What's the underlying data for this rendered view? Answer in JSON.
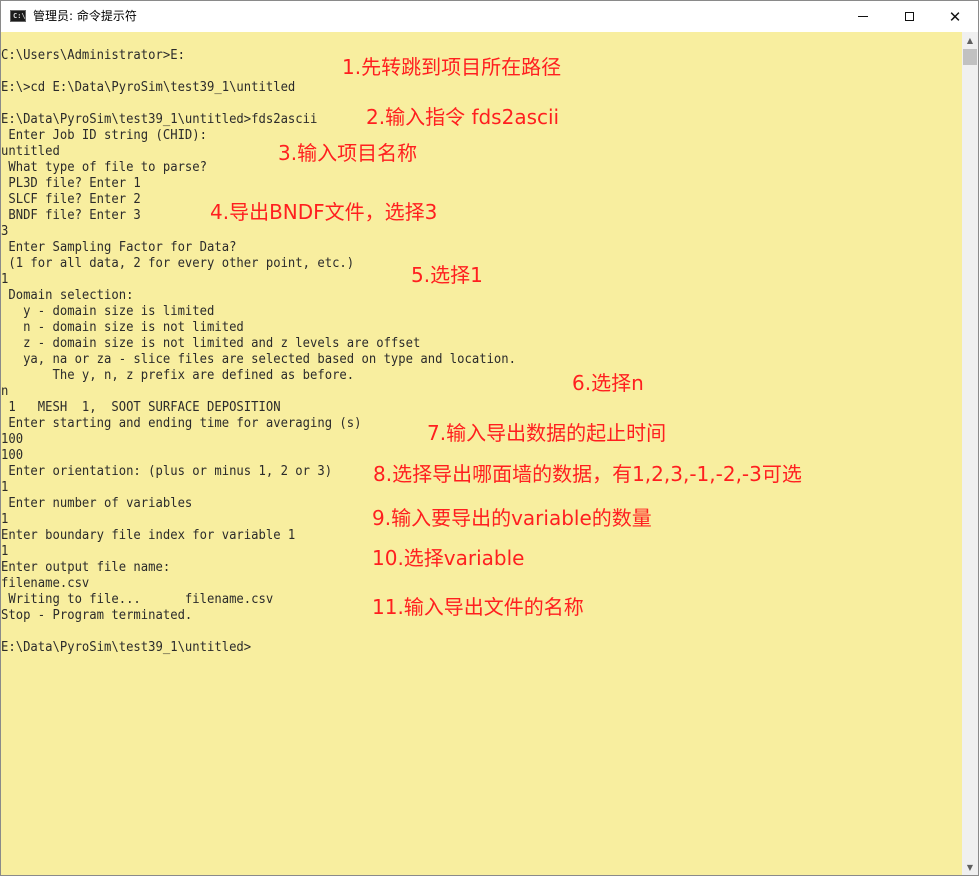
{
  "window": {
    "title": "管理员: 命令提示符",
    "icon": "cmd-console-icon",
    "icon_text": "C:\\",
    "controls": {
      "minimize": "minimize-icon",
      "maximize": "maximize-icon",
      "close": "close-icon"
    },
    "close_glyph": "✕",
    "background": "#f8ee9f",
    "annotation_color": "#ff1f1f"
  },
  "console_lines": [
    "C:\\Users\\Administrator>E:",
    "",
    "E:\\>cd E:\\Data\\PyroSim\\test39_1\\untitled",
    "",
    "E:\\Data\\PyroSim\\test39_1\\untitled>fds2ascii",
    " Enter Job ID string (CHID):",
    "untitled",
    " What type of file to parse?",
    " PL3D file? Enter 1",
    " SLCF file? Enter 2",
    " BNDF file? Enter 3",
    "3",
    " Enter Sampling Factor for Data?",
    " (1 for all data, 2 for every other point, etc.)",
    "1",
    " Domain selection:",
    "   y - domain size is limited",
    "   n - domain size is not limited",
    "   z - domain size is not limited and z levels are offset",
    "   ya, na or za - slice files are selected based on type and location.",
    "       The y, n, z prefix are defined as before.",
    "n",
    " 1   MESH  1,  SOOT SURFACE DEPOSITION",
    " Enter starting and ending time for averaging (s)",
    "100",
    "100",
    " Enter orientation: (plus or minus 1, 2 or 3)",
    "1",
    " Enter number of variables",
    "1",
    "Enter boundary file index for variable 1",
    "1",
    "Enter output file name:",
    "filename.csv",
    " Writing to file...      filename.csv",
    "Stop - Program terminated.",
    "",
    "E:\\Data\\PyroSim\\test39_1\\untitled>"
  ],
  "annotations": [
    "1.先转跳到项目所在路径",
    "2.输入指令 fds2ascii",
    "3.输入项目名称",
    "4.导出BNDF文件，选择3",
    "5.选择1",
    "6.选择n",
    "7.输入导出数据的起止时间",
    "8.选择导出哪面墙的数据，有1,2,3,-1,-2,-3可选",
    "9.输入要导出的variable的数量",
    "10.选择variable",
    "11.输入导出文件的名称"
  ],
  "scrollbar": {
    "up": "scroll-up-arrow-icon",
    "down": "scroll-down-arrow-icon",
    "up_glyph": "▲",
    "down_glyph": "▼"
  }
}
